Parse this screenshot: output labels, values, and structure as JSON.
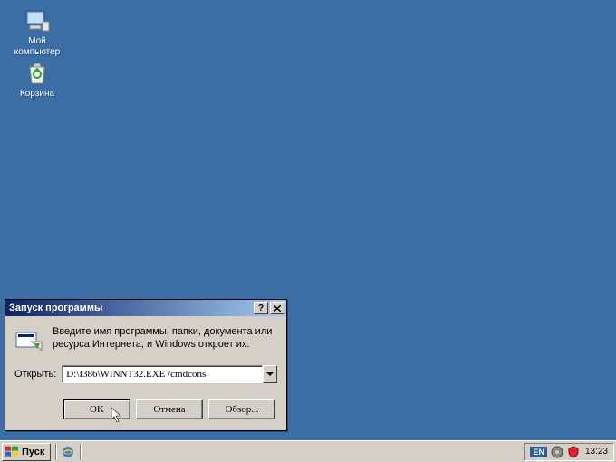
{
  "desktop": {
    "icons": [
      {
        "name": "my-computer",
        "label": "Мой\nкомпьютер"
      },
      {
        "name": "recycle-bin",
        "label": "Корзина"
      }
    ]
  },
  "dialog": {
    "title": "Запуск программы",
    "instruction": "Введите имя программы, папки, документа или ресурса Интернета, и Windows откроет их.",
    "open_label": "Открыть:",
    "input_value": "D:\\I386\\WINNT32.EXE /cmdcons",
    "buttons": {
      "ok": "OK",
      "cancel": "Отмена",
      "browse": "Обзор..."
    }
  },
  "taskbar": {
    "start": "Пуск",
    "lang": "EN",
    "clock": "13:23"
  }
}
